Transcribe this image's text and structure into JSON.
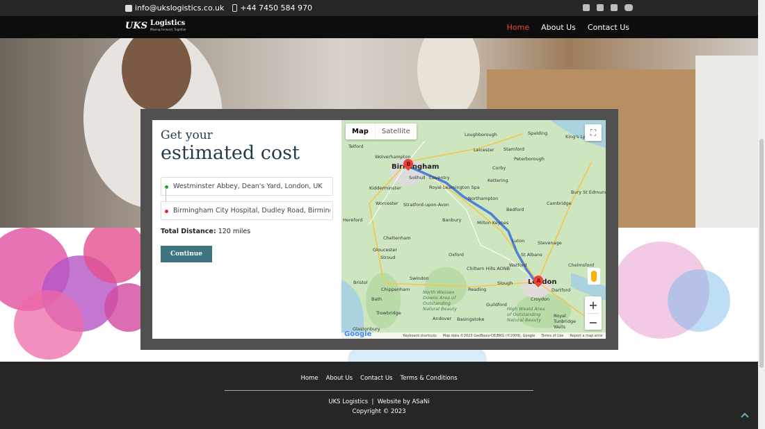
{
  "topbar": {
    "email": "info@ukslogistics.co.uk",
    "phone": "+44 7450 584 970",
    "social": [
      "facebook-icon",
      "twitter-icon",
      "linkedin-icon",
      "youtube-icon"
    ]
  },
  "nav": {
    "logo_mark": "UKS",
    "logo_brand": "Logistics",
    "logo_tagline": "Moving Forward, Together",
    "items": [
      {
        "label": "Home",
        "active": true
      },
      {
        "label": "About Us",
        "active": false
      },
      {
        "label": "Contact Us",
        "active": false
      }
    ],
    "active_color": "#f04a3b"
  },
  "form": {
    "heading_small": "Get your",
    "heading_large": "estimated cost",
    "origin": "Westminster Abbey, Dean's Yard, London, UK",
    "destination": "Birmingham City Hospital, Dudley Road, Birmingham",
    "distance_label": "Total Distance:",
    "distance_value": "120 miles",
    "continue_label": "Continue",
    "accent_color": "#3d7480"
  },
  "map": {
    "type_map": "Map",
    "type_satellite": "Satellite",
    "zoom_in": "+",
    "zoom_out": "−",
    "marker_a": "A",
    "marker_b": "B",
    "attribution": {
      "shortcuts": "Keyboard shortcuts",
      "data": "Map data ©2023 GeoBasis-DE/BKG (©2009), Google",
      "terms": "Terms of Use",
      "report": "Report a map error"
    },
    "google": "Google",
    "places": {
      "birmingham": "Birmingham",
      "london": "London",
      "wolverhampton": "Wolverhampton",
      "telford": "Telford",
      "leicester": "Leicester",
      "loughborough": "Loughborough",
      "peterborough": "Peterborough",
      "northampton": "Northampton",
      "coventry": "Coventry",
      "oxford": "Oxford",
      "reading": "Reading",
      "cambridge": "Cambridge",
      "bedford": "Bedford",
      "luton": "Luton",
      "watford": "Watford",
      "chelmsford": "Chelmsford",
      "bristol": "Bristol",
      "gloucester": "Gloucester",
      "cheltenham": "Cheltenham",
      "swindon": "Swindon",
      "bath": "Bath",
      "slough": "Slough",
      "croydon": "Croydon",
      "worcester": "Worcester",
      "kidderminster": "Kidderminster",
      "hereford": "Hereford",
      "banbury": "Banbury",
      "milton_keynes": "Milton Keynes",
      "stevenage": "Stevenage",
      "st_albans": "St Albans",
      "basingstoke": "Basingstoke",
      "guildford": "Guildford",
      "stamford": "Stamford",
      "spalding": "Spalding",
      "corby": "Corby",
      "kettering": "Kettering",
      "dartford": "Dartford",
      "royal_leamington_spa": "Royal Leamington Spa",
      "stratford": "Stratford-upon-Avon",
      "solihull": "Solihull",
      "chippenham": "Chippenham",
      "trowbridge": "Trowbridge",
      "andover": "Andover",
      "glastonbury": "Glastonbury",
      "royal_tunbridge_wells": "Royal Tunbridge Wells",
      "kings_lynn": "King's Lynn",
      "bury_st_edmunds": "Bury St Edmunds",
      "stroud": "Stroud",
      "north_wessex_downs": "North Wessex Downs Area of Outstanding Natural Beauty",
      "chilterns": "Chiltern Hills AONB",
      "high_weald": "High Weald Area of Outstanding Natural Beauty"
    }
  },
  "footer": {
    "links": [
      "Home",
      "About Us",
      "Contact Us",
      "Terms & Conditions"
    ],
    "brand": "UKS Logistics",
    "separator": "|",
    "website_by": "Website by ASaNi",
    "copyright": "Copyright © 2023"
  }
}
